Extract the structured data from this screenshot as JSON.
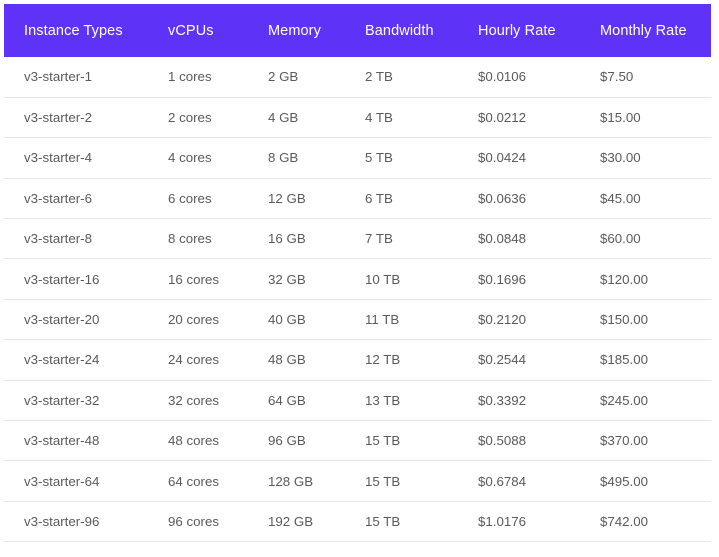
{
  "table": {
    "accent_color": "#5e33f7",
    "header_text_color": "#ffffff",
    "body_text_color": "#5a5a5a",
    "row_border_color": "#e6e6e6",
    "columns": [
      {
        "key": "instance",
        "label": "Instance Types"
      },
      {
        "key": "vcpus",
        "label": "vCPUs"
      },
      {
        "key": "memory",
        "label": "Memory"
      },
      {
        "key": "bandwidth",
        "label": "Bandwidth"
      },
      {
        "key": "hourly",
        "label": "Hourly Rate"
      },
      {
        "key": "monthly",
        "label": "Monthly Rate"
      }
    ],
    "rows": [
      {
        "instance": "v3-starter-1",
        "vcpus": "1 cores",
        "memory": "2 GB",
        "bandwidth": "2 TB",
        "hourly": "$0.0106",
        "monthly": "$7.50"
      },
      {
        "instance": "v3-starter-2",
        "vcpus": "2 cores",
        "memory": "4 GB",
        "bandwidth": "4 TB",
        "hourly": "$0.0212",
        "monthly": "$15.00"
      },
      {
        "instance": "v3-starter-4",
        "vcpus": "4 cores",
        "memory": "8 GB",
        "bandwidth": "5 TB",
        "hourly": "$0.0424",
        "monthly": "$30.00"
      },
      {
        "instance": "v3-starter-6",
        "vcpus": "6 cores",
        "memory": "12 GB",
        "bandwidth": "6 TB",
        "hourly": "$0.0636",
        "monthly": "$45.00"
      },
      {
        "instance": "v3-starter-8",
        "vcpus": "8 cores",
        "memory": "16 GB",
        "bandwidth": "7 TB",
        "hourly": "$0.0848",
        "monthly": "$60.00"
      },
      {
        "instance": "v3-starter-16",
        "vcpus": "16 cores",
        "memory": "32 GB",
        "bandwidth": "10 TB",
        "hourly": "$0.1696",
        "monthly": "$120.00"
      },
      {
        "instance": "v3-starter-20",
        "vcpus": "20 cores",
        "memory": "40 GB",
        "bandwidth": "11 TB",
        "hourly": "$0.2120",
        "monthly": "$150.00"
      },
      {
        "instance": "v3-starter-24",
        "vcpus": "24 cores",
        "memory": "48 GB",
        "bandwidth": "12 TB",
        "hourly": "$0.2544",
        "monthly": "$185.00"
      },
      {
        "instance": "v3-starter-32",
        "vcpus": "32 cores",
        "memory": "64 GB",
        "bandwidth": "13 TB",
        "hourly": "$0.3392",
        "monthly": "$245.00"
      },
      {
        "instance": "v3-starter-48",
        "vcpus": "48 cores",
        "memory": "96 GB",
        "bandwidth": "15 TB",
        "hourly": "$0.5088",
        "monthly": "$370.00"
      },
      {
        "instance": "v3-starter-64",
        "vcpus": "64 cores",
        "memory": "128 GB",
        "bandwidth": "15 TB",
        "hourly": "$0.6784",
        "monthly": "$495.00"
      },
      {
        "instance": "v3-starter-96",
        "vcpus": "96 cores",
        "memory": "192 GB",
        "bandwidth": "15 TB",
        "hourly": "$1.0176",
        "monthly": "$742.00"
      }
    ]
  }
}
